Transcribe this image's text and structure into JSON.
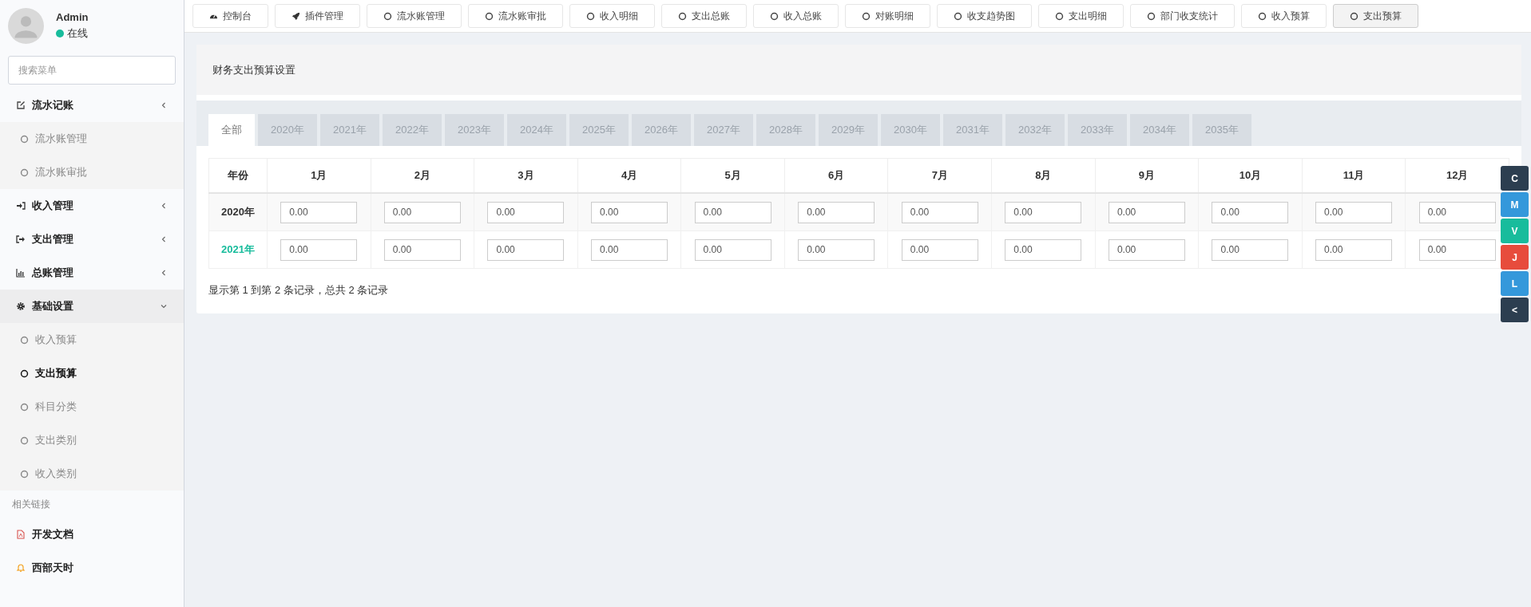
{
  "user": {
    "name": "Admin",
    "status": "在线"
  },
  "search": {
    "placeholder": "搜索菜单"
  },
  "menu": [
    {
      "label": "流水记账",
      "kind": "edit",
      "expanded": false,
      "active": false,
      "children": [
        {
          "label": "流水账管理",
          "selected": false
        },
        {
          "label": "流水账审批",
          "selected": false
        }
      ]
    },
    {
      "label": "收入管理",
      "kind": "signin",
      "expanded": false,
      "active": false
    },
    {
      "label": "支出管理",
      "kind": "signout",
      "expanded": false,
      "active": false
    },
    {
      "label": "总账管理",
      "kind": "chart",
      "expanded": false,
      "active": false
    },
    {
      "label": "基础设置",
      "kind": "gear",
      "expanded": true,
      "active": true,
      "children": [
        {
          "label": "收入预算",
          "selected": false
        },
        {
          "label": "支出预算",
          "selected": true
        },
        {
          "label": "科目分类",
          "selected": false
        },
        {
          "label": "支出类别",
          "selected": false
        },
        {
          "label": "收入类别",
          "selected": false
        }
      ]
    }
  ],
  "links_header": "相关链接",
  "links": [
    {
      "label": "开发文档",
      "kind": "pdf"
    },
    {
      "label": "西部天时",
      "kind": "bell"
    }
  ],
  "top_tabs": [
    {
      "label": "控制台",
      "kind": "gauge",
      "selected": false
    },
    {
      "label": "插件管理",
      "kind": "rocket",
      "selected": false
    },
    {
      "label": "流水账管理",
      "kind": "circle",
      "selected": false
    },
    {
      "label": "流水账审批",
      "kind": "circle",
      "selected": false
    },
    {
      "label": "收入明细",
      "kind": "circle",
      "selected": false
    },
    {
      "label": "支出总账",
      "kind": "circle",
      "selected": false
    },
    {
      "label": "收入总账",
      "kind": "circle",
      "selected": false
    },
    {
      "label": "对账明细",
      "kind": "circle",
      "selected": false
    },
    {
      "label": "收支趋势图",
      "kind": "circle",
      "selected": false
    },
    {
      "label": "支出明细",
      "kind": "circle",
      "selected": false
    },
    {
      "label": "部门收支统计",
      "kind": "circle",
      "selected": false
    },
    {
      "label": "收入预算",
      "kind": "circle",
      "selected": false
    },
    {
      "label": "支出预算",
      "kind": "circle",
      "selected": true
    }
  ],
  "panel_title": "财务支出预算设置",
  "year_tabs": [
    {
      "label": "全部",
      "selected": true
    },
    {
      "label": "2020年",
      "selected": false
    },
    {
      "label": "2021年",
      "selected": false
    },
    {
      "label": "2022年",
      "selected": false
    },
    {
      "label": "2023年",
      "selected": false
    },
    {
      "label": "2024年",
      "selected": false
    },
    {
      "label": "2025年",
      "selected": false
    },
    {
      "label": "2026年",
      "selected": false
    },
    {
      "label": "2027年",
      "selected": false
    },
    {
      "label": "2028年",
      "selected": false
    },
    {
      "label": "2029年",
      "selected": false
    },
    {
      "label": "2030年",
      "selected": false
    },
    {
      "label": "2031年",
      "selected": false
    },
    {
      "label": "2032年",
      "selected": false
    },
    {
      "label": "2033年",
      "selected": false
    },
    {
      "label": "2034年",
      "selected": false
    },
    {
      "label": "2035年",
      "selected": false
    }
  ],
  "table": {
    "columns": [
      "年份",
      "1月",
      "2月",
      "3月",
      "4月",
      "5月",
      "6月",
      "7月",
      "8月",
      "9月",
      "10月",
      "11月",
      "12月"
    ],
    "rows": [
      {
        "year": "2020年",
        "current": false,
        "values": [
          "0.00",
          "0.00",
          "0.00",
          "0.00",
          "0.00",
          "0.00",
          "0.00",
          "0.00",
          "0.00",
          "0.00",
          "0.00",
          "0.00"
        ]
      },
      {
        "year": "2021年",
        "current": true,
        "values": [
          "0.00",
          "0.00",
          "0.00",
          "0.00",
          "0.00",
          "0.00",
          "0.00",
          "0.00",
          "0.00",
          "0.00",
          "0.00",
          "0.00"
        ]
      }
    ]
  },
  "footer": "显示第 1 到第 2 条记录，总共 2 条记录",
  "side_buttons": [
    {
      "label": "C",
      "color": "#2c3e50"
    },
    {
      "label": "M",
      "color": "#3498db"
    },
    {
      "label": "V",
      "color": "#18bc9c"
    },
    {
      "label": "J",
      "color": "#e74c3c"
    },
    {
      "label": "L",
      "color": "#3498db"
    },
    {
      "label": "<",
      "color": "#2c3e50"
    }
  ]
}
